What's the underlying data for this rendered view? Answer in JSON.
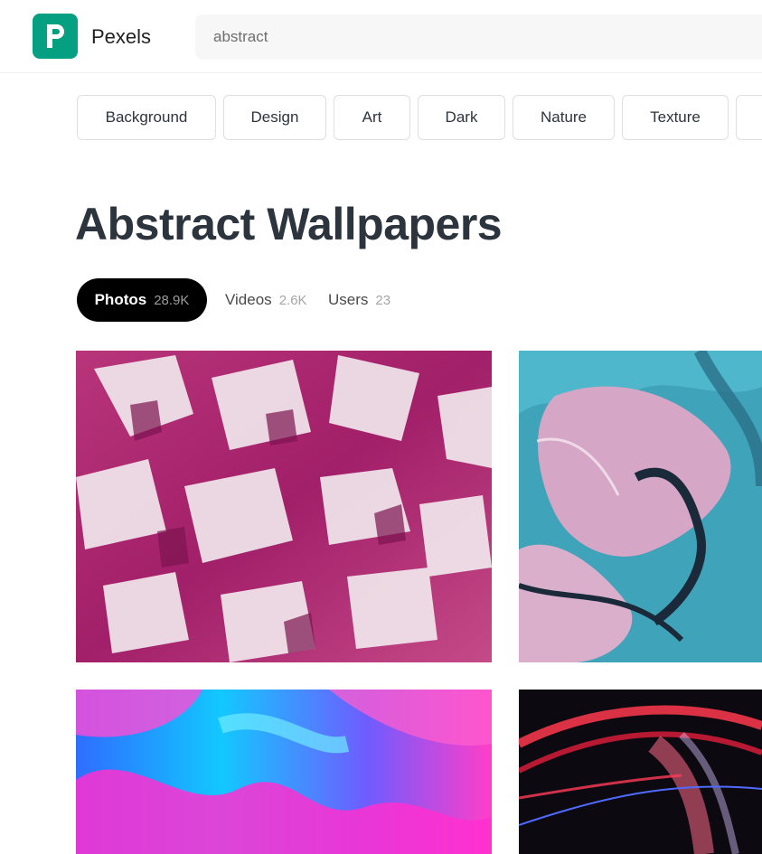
{
  "header": {
    "brand": "Pexels",
    "search_value": "abstract",
    "logo_icon": "pexels-logo-icon",
    "accent_color": "#05a081"
  },
  "chips": [
    "Background",
    "Design",
    "Art",
    "Dark",
    "Nature",
    "Texture"
  ],
  "main": {
    "title": "Abstract Wallpapers",
    "tabs": [
      {
        "label": "Photos",
        "count": "28.9K",
        "active": true
      },
      {
        "label": "Videos",
        "count": "2.6K",
        "active": false
      },
      {
        "label": "Users",
        "count": "23",
        "active": false
      }
    ]
  }
}
